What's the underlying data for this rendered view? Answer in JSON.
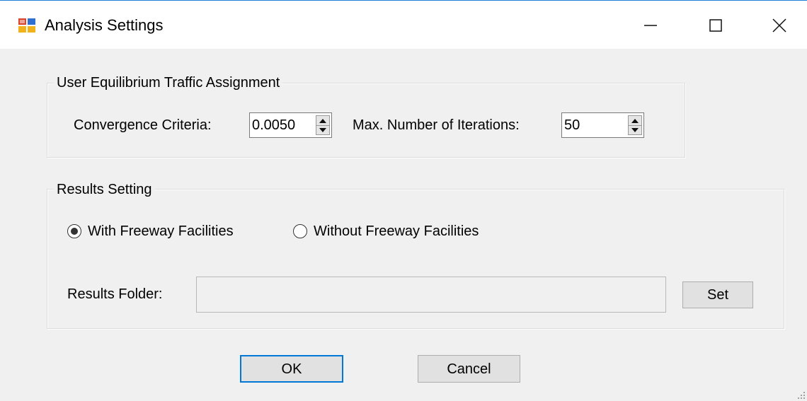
{
  "window": {
    "title": "Analysis Settings"
  },
  "traffic_assignment": {
    "group_title": "User Equilibrium Traffic Assignment",
    "convergence_label": "Convergence Criteria:",
    "convergence_value": "0.0050",
    "iterations_label": "Max. Number of Iterations:",
    "iterations_value": "50"
  },
  "results": {
    "group_title": "Results Setting",
    "radio_options": [
      {
        "label": "With Freeway Facilities",
        "selected": true
      },
      {
        "label": "Without Freeway Facilities",
        "selected": false
      }
    ],
    "folder_label": "Results Folder:",
    "folder_value": "",
    "set_button": "Set"
  },
  "footer": {
    "ok_button": "OK",
    "cancel_button": "Cancel"
  },
  "colors": {
    "window_bg": "#f0f0f0",
    "titlebar_bg": "#ffffff",
    "accent": "#0078d7"
  },
  "icons": [
    "app-icon",
    "minimize-icon",
    "maximize-icon",
    "close-icon",
    "spin-up-icon",
    "spin-down-icon",
    "resize-grip-icon"
  ]
}
